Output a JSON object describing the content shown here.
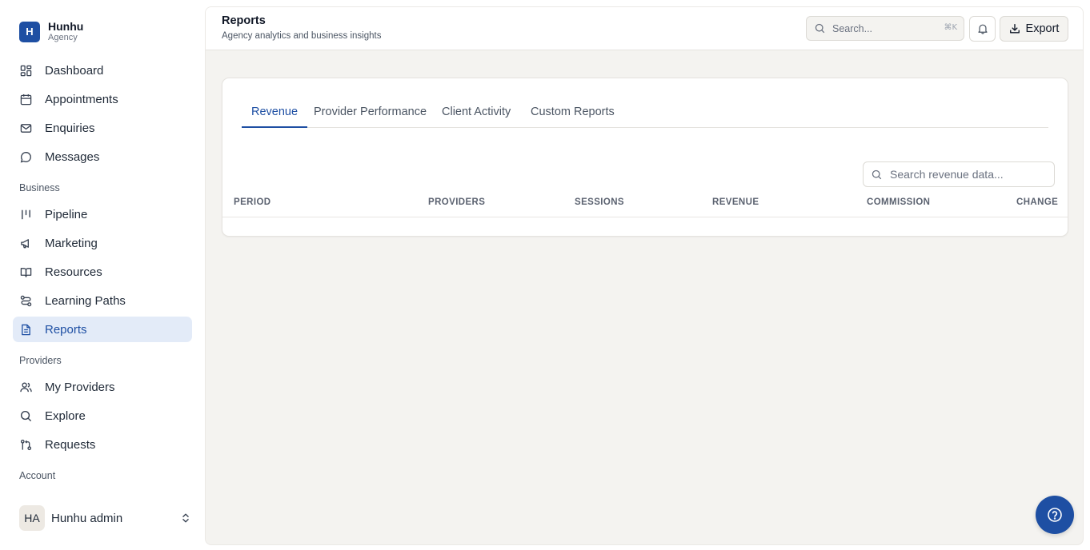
{
  "brand": {
    "initial": "H",
    "name": "Hunhu",
    "subtitle": "Agency"
  },
  "nav": {
    "main": [
      {
        "label": "Dashboard",
        "icon": "dashboard-icon"
      },
      {
        "label": "Appointments",
        "icon": "calendar-icon"
      },
      {
        "label": "Enquiries",
        "icon": "mail-icon"
      },
      {
        "label": "Messages",
        "icon": "message-icon"
      }
    ],
    "business_label": "Business",
    "business": [
      {
        "label": "Pipeline",
        "icon": "pipeline-icon"
      },
      {
        "label": "Marketing",
        "icon": "megaphone-icon"
      },
      {
        "label": "Resources",
        "icon": "book-icon"
      },
      {
        "label": "Learning Paths",
        "icon": "route-icon"
      },
      {
        "label": "Reports",
        "icon": "file-text-icon",
        "active": true
      }
    ],
    "providers_label": "Providers",
    "providers": [
      {
        "label": "My Providers",
        "icon": "users-icon"
      },
      {
        "label": "Explore",
        "icon": "search-icon"
      },
      {
        "label": "Requests",
        "icon": "pull-request-icon"
      }
    ],
    "account_label": "Account"
  },
  "user": {
    "initials": "HA",
    "name": "Hunhu admin"
  },
  "header": {
    "title": "Reports",
    "subtitle": "Agency analytics and business insights",
    "search_placeholder": "Search...",
    "search_shortcut": "⌘K",
    "export_label": "Export"
  },
  "tabs": [
    "Revenue",
    "Provider Performance",
    "Client Activity",
    "Custom Reports"
  ],
  "active_tab": "Revenue",
  "table": {
    "search_placeholder": "Search revenue data...",
    "columns": [
      "PERIOD",
      "PROVIDERS",
      "SESSIONS",
      "REVENUE",
      "COMMISSION",
      "CHANGE"
    ],
    "rows": []
  },
  "colors": {
    "accent": "#1e4fa3",
    "active_bg": "#e3ebf8",
    "canvas": "#f4f3f0"
  }
}
